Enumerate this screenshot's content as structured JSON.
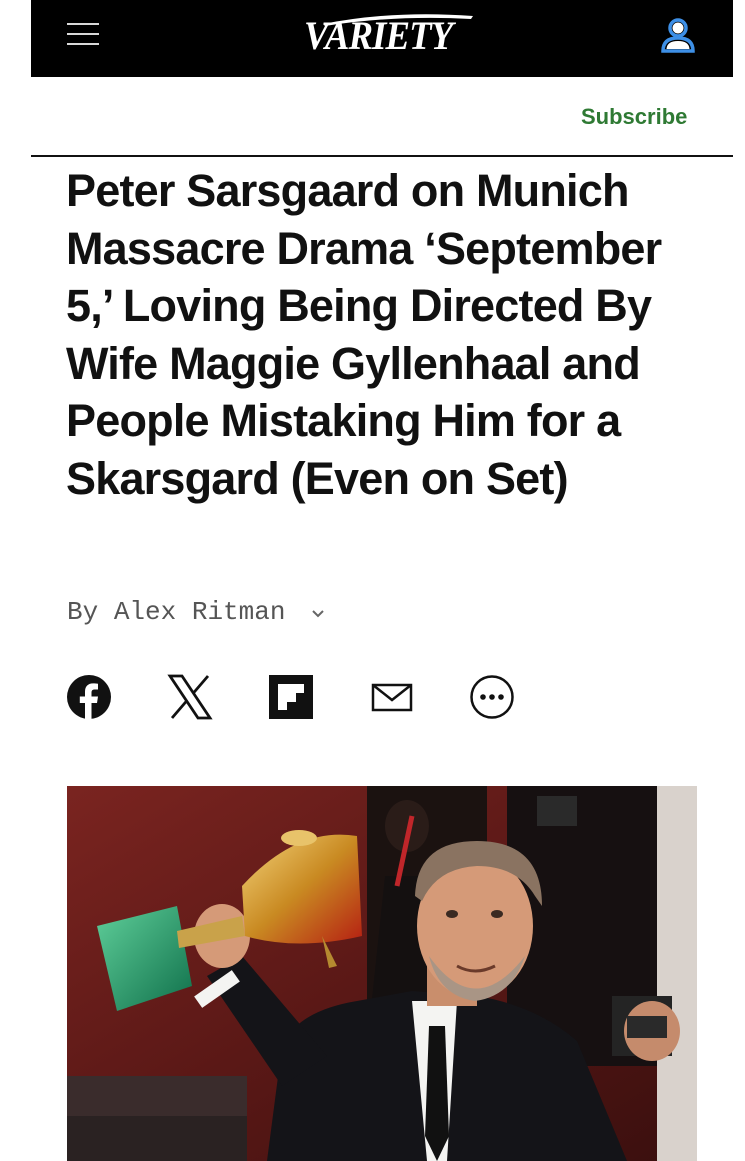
{
  "header": {
    "logo_text": "VARIETY",
    "menu_icon": "hamburger-menu-icon",
    "account_icon": "user-account-icon",
    "accent_color": "#2f7a34"
  },
  "subscribe_label": "Subscribe",
  "article": {
    "headline": "Peter Sarsgaard on Munich Massacre Drama ‘September 5,’ Loving Being Directed By Wife Maggie Gyllenhaal and People Mistaking Him for a Skarsgard (Even on Set)",
    "byline_prefix": "By",
    "author": "Alex Ritman",
    "share": [
      "facebook-icon",
      "x-icon",
      "flipboard-icon",
      "email-icon",
      "more-options-icon"
    ],
    "hero_image": "Peter Sarsgaard holding trophy photo"
  }
}
